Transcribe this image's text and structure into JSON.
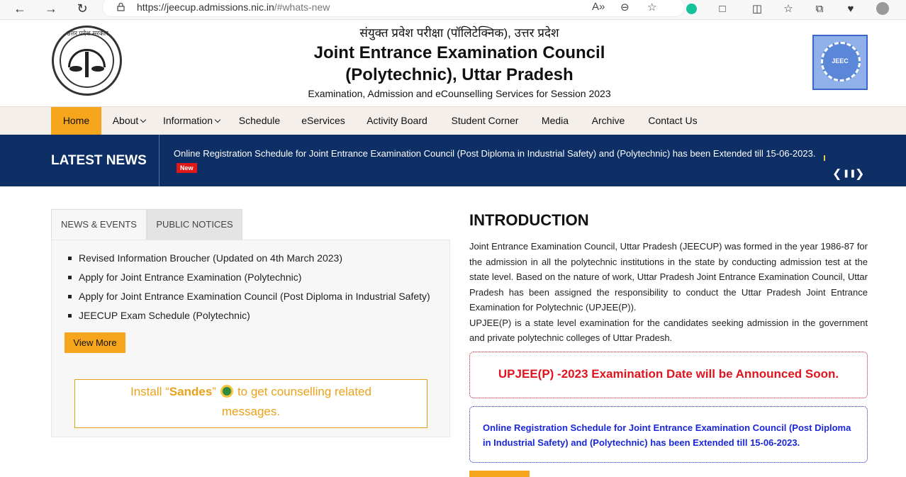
{
  "browser": {
    "url_host": "https://jeecup.admissions.nic.in",
    "url_path": "/#whats-new",
    "read_aloud": "A»",
    "zoom": "⊖",
    "favorite": "☆"
  },
  "header": {
    "hindi_title": "संयुक्त प्रवेश परीक्षा (पॉलिटेक्निक), उत्तर प्रदेश",
    "title_line1": "Joint Entrance Examination Council",
    "title_line2": "(Polytechnic), Uttar Pradesh",
    "subtitle": "Examination, Admission and eCounselling Services for Session 2023",
    "emblem_text": "उत्तर प्रदेश सरकार",
    "jeec_logo_text": "JEEC"
  },
  "nav": {
    "items": [
      {
        "label": "Home"
      },
      {
        "label": "About"
      },
      {
        "label": "Information"
      },
      {
        "label": "Schedule"
      },
      {
        "label": "eServices"
      },
      {
        "label": "Activity Board"
      },
      {
        "label": "Student Corner"
      },
      {
        "label": "Media"
      },
      {
        "label": "Archive"
      },
      {
        "label": "Contact Us"
      }
    ]
  },
  "latest_news": {
    "label": "LATEST NEWS",
    "text": "Online Registration Schedule for Joint Entrance Examination Council (Post Diploma in Industrial Safety) and (Polytechnic) has been Extended till 15-06-2023.",
    "badge": "New",
    "prev": "❮",
    "pause": "❚❚",
    "next": "❯"
  },
  "tabs": {
    "news_events": "NEWS & EVENTS",
    "public_notices": "PUBLIC NOTICES"
  },
  "news_list": [
    "Revised Information Broucher (Updated on 4th March 2023)",
    "Apply for Joint Entrance Examination (Polytechnic)",
    "Apply for Joint Entrance Examination Council (Post Diploma in Industrial Safety)",
    "JEECUP Exam Schedule (Polytechnic)"
  ],
  "view_more": "View More",
  "sandes": {
    "pre": "Install “",
    "brand": "Sandes",
    "post": "”",
    "after_icon": "to get counselling related",
    "line2": "messages."
  },
  "intro": {
    "heading": "INTRODUCTION",
    "para1": "Joint Entrance Examination Council, Uttar Pradesh (JEECUP) was formed in the year 1986-87 for the admission in all the polytechnic institutions in the state by conducting admission test at the state level. Based on the nature of work, Uttar Pradesh Joint Entrance Examination Council, Uttar Pradesh has been assigned the responsibility to conduct the Uttar Pradesh Joint Entrance Examination for Polytechnic (UPJEE(P)).",
    "para2": "UPJEE(P) is a state level examination for the candidates seeking admission in the government and private polytechnic colleges of Uttar Pradesh."
  },
  "announcement": "UPJEE(P) -2023 Examination Date will be Announced Soon.",
  "notice_box": "Online Registration Schedule for Joint Entrance Examination Council (Post Diploma in Industrial Safety) and (Polytechnic) has been Extended till 15-06-2023.",
  "colors": {
    "accent": "#f5a61d",
    "news_bg": "#0d2f66",
    "alert_red": "#e0141e",
    "notice_blue": "#1a27d8"
  }
}
